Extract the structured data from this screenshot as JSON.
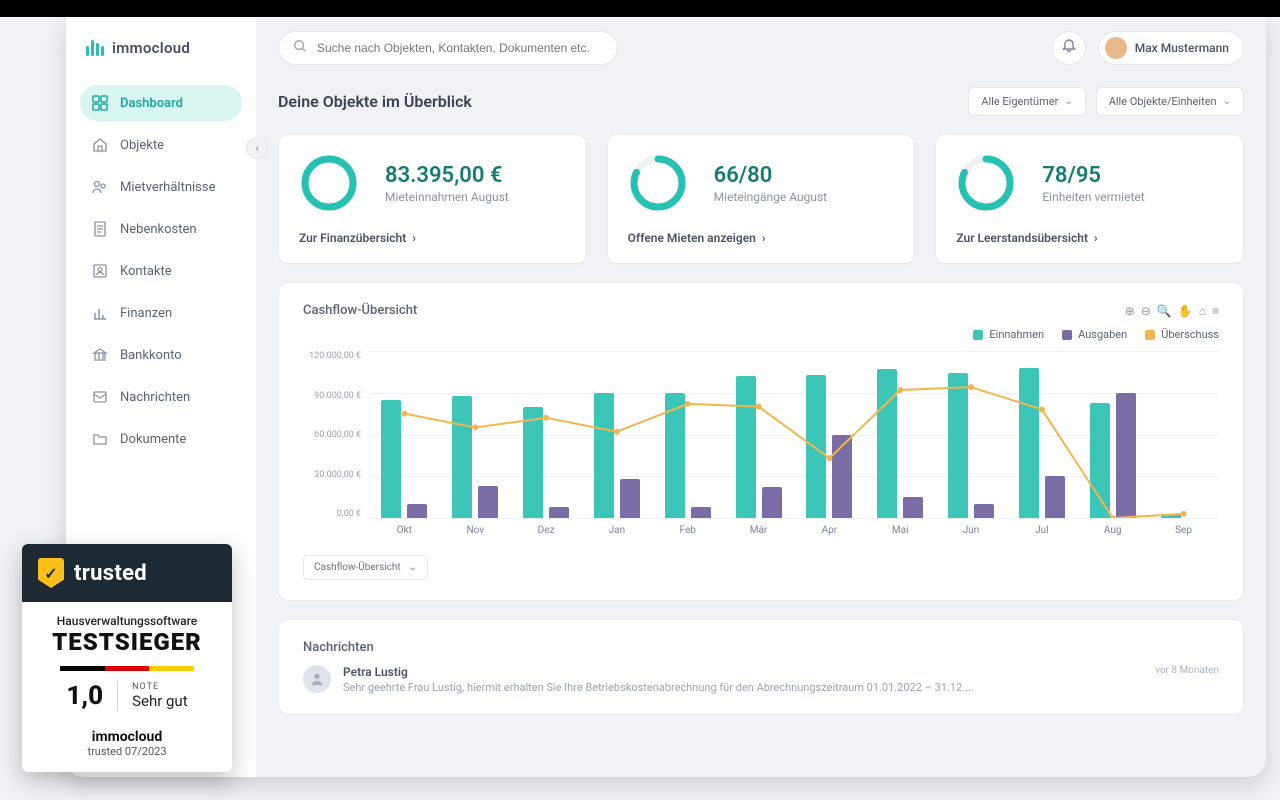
{
  "brand": {
    "name": "immocloud"
  },
  "search": {
    "placeholder": "Suche nach Objekten, Kontakten, Dokumenten etc."
  },
  "user": {
    "name": "Max Mustermann"
  },
  "sidebar": {
    "items": [
      {
        "label": "Dashboard",
        "active": true
      },
      {
        "label": "Objekte"
      },
      {
        "label": "Mietverhältnisse"
      },
      {
        "label": "Nebenkosten"
      },
      {
        "label": "Kontakte"
      },
      {
        "label": "Finanzen"
      },
      {
        "label": "Bankkonto"
      },
      {
        "label": "Nachrichten"
      },
      {
        "label": "Dokumente"
      }
    ]
  },
  "overview": {
    "title": "Deine Objekte im Überblick",
    "filter_owner": "Alle Eigentümer",
    "filter_units": "Alle Objekte/Einheiten"
  },
  "cards": [
    {
      "value": "83.395,00 €",
      "sub": "Mieteinnahmen August",
      "link": "Zur Finanzübersicht",
      "pct": 100
    },
    {
      "value": "66/80",
      "sub": "Mieteingänge August",
      "link": "Offene Mieten anzeigen",
      "pct": 82
    },
    {
      "value": "78/95",
      "sub": "Einheiten vermietet",
      "link": "Zur Leerstandsübersicht",
      "pct": 82
    }
  ],
  "chart": {
    "title": "Cashflow-Übersicht",
    "legend": {
      "income": "Einnahmen",
      "expense": "Ausgaben",
      "surplus": "Überschuss"
    },
    "selector": "Cashflow-Übersicht",
    "colors": {
      "income": "#3cc6b8",
      "expense": "#7a6ca5",
      "surplus": "#f0b650"
    }
  },
  "chart_data": {
    "type": "bar",
    "title": "Cashflow-Übersicht",
    "ylabel": "€",
    "ylim": [
      0,
      120000
    ],
    "y_ticks": [
      "120.000,00 €",
      "90.000,00 €",
      "60.000,00 €",
      "30.000,00 €",
      "0,00 €"
    ],
    "categories": [
      "Okt",
      "Nov",
      "Dez",
      "Jan",
      "Feb",
      "Mär",
      "Apr",
      "Mai",
      "Jun",
      "Jul",
      "Aug",
      "Sep"
    ],
    "series": [
      {
        "name": "Einnahmen",
        "values": [
          85000,
          88000,
          80000,
          90000,
          90000,
          102000,
          103000,
          107000,
          104000,
          108000,
          83000,
          3000
        ]
      },
      {
        "name": "Ausgaben",
        "values": [
          10000,
          23000,
          8000,
          28000,
          8000,
          22000,
          60000,
          15000,
          10000,
          30000,
          90000,
          0
        ]
      },
      {
        "name": "Überschuss",
        "values": [
          75000,
          65000,
          72000,
          62000,
          82000,
          80000,
          43000,
          92000,
          94000,
          78000,
          -7000,
          3000
        ]
      }
    ]
  },
  "messages": {
    "title": "Nachrichten",
    "items": [
      {
        "name": "Petra Lustig",
        "text": "Sehr geehrte Frau Lustig, hiermit erhalten Sie Ihre Betriebskostenabrechnung für den Abrechnungszeitraum 01.01.2022 – 31.12....",
        "time": "vor 8 Monaten"
      }
    ]
  },
  "trusted": {
    "brand": "trusted",
    "category": "Hausverwaltungssoftware",
    "title": "TESTSIEGER",
    "score": "1,0",
    "note_label": "NOTE",
    "grade": "Sehr gut",
    "product": "immocloud",
    "date": "trusted 07/2023"
  }
}
